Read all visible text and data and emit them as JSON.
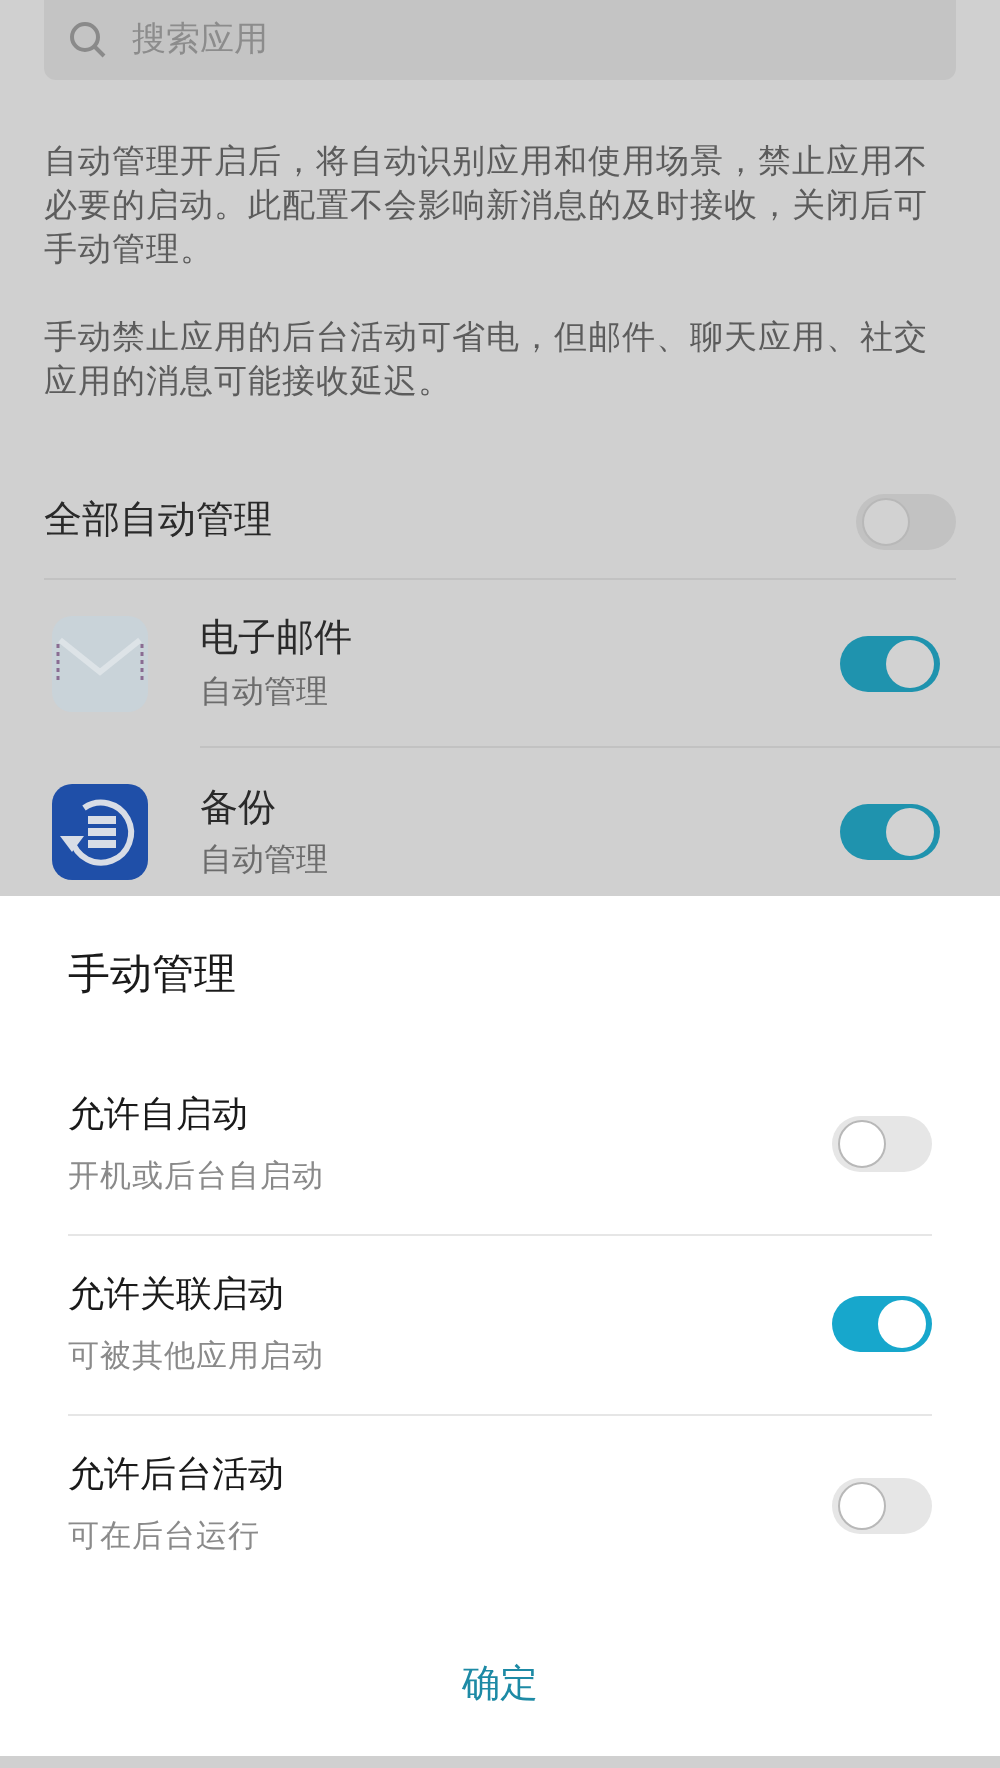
{
  "search": {
    "placeholder": "搜索应用"
  },
  "description": [
    "自动管理开启后，将自动识别应用和使用场景，禁止应用不必要的启动。此配置不会影响新消息的及时接收，关闭后可手动管理。",
    "手动禁止应用的后台活动可省电，但邮件、聊天应用、社交应用的消息可能接收延迟。"
  ],
  "all_auto": {
    "label": "全部自动管理",
    "on": false
  },
  "apps": [
    {
      "name": "电子邮件",
      "status": "自动管理",
      "on": true,
      "kind": "mail"
    },
    {
      "name": "备份",
      "status": "自动管理",
      "on": true,
      "kind": "backup"
    }
  ],
  "dialog": {
    "title": "手动管理",
    "options": [
      {
        "label": "允许自启动",
        "hint": "开机或后台自启动",
        "on": false
      },
      {
        "label": "允许关联启动",
        "hint": "可被其他应用启动",
        "on": true
      },
      {
        "label": "允许后台活动",
        "hint": "可在后台运行",
        "on": false
      }
    ],
    "confirm": "确定"
  }
}
